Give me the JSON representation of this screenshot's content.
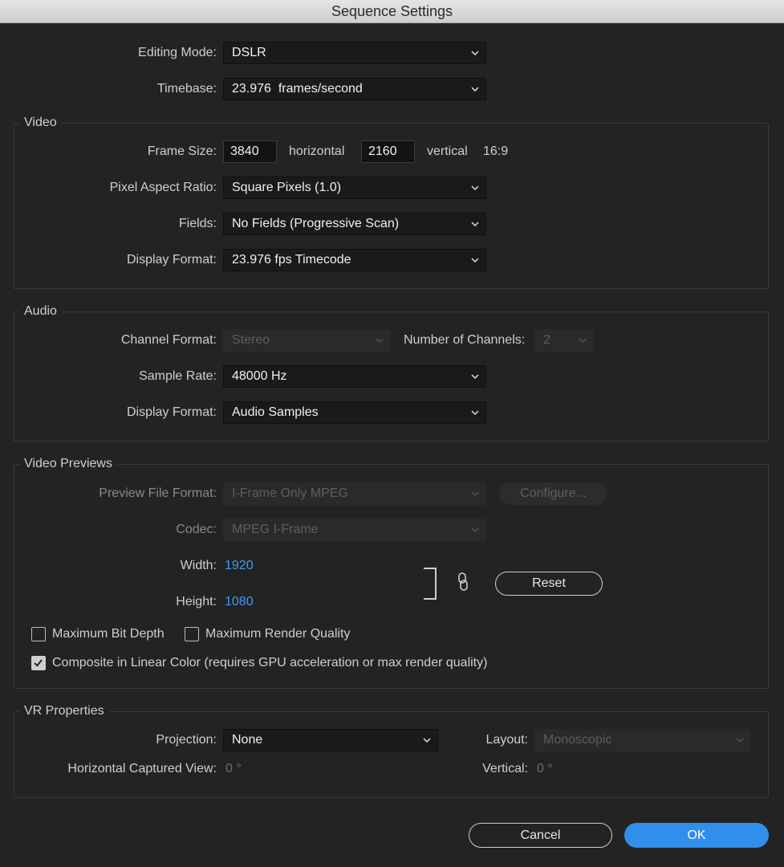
{
  "window": {
    "title": "Sequence Settings"
  },
  "general": {
    "editing_mode_label": "Editing Mode:",
    "editing_mode_value": "DSLR",
    "timebase_label": "Timebase:",
    "timebase_value": "23.976  frames/second"
  },
  "video": {
    "title": "Video",
    "frame_size_label": "Frame Size:",
    "frame_width": "3840",
    "horizontal_label": "horizontal",
    "frame_height": "2160",
    "vertical_label": "vertical",
    "aspect": "16:9",
    "par_label": "Pixel Aspect Ratio:",
    "par_value": "Square Pixels (1.0)",
    "fields_label": "Fields:",
    "fields_value": "No Fields (Progressive Scan)",
    "display_format_label": "Display Format:",
    "display_format_value": "23.976 fps Timecode"
  },
  "audio": {
    "title": "Audio",
    "channel_format_label": "Channel Format:",
    "channel_format_value": "Stereo",
    "num_channels_label": "Number of Channels:",
    "num_channels_value": "2",
    "sample_rate_label": "Sample Rate:",
    "sample_rate_value": "48000 Hz",
    "display_format_label": "Display Format:",
    "display_format_value": "Audio Samples"
  },
  "previews": {
    "title": "Video Previews",
    "file_format_label": "Preview File Format:",
    "file_format_value": "I-Frame Only MPEG",
    "configure_label": "Configure...",
    "codec_label": "Codec:",
    "codec_value": "MPEG I-Frame",
    "width_label": "Width:",
    "width_value": "1920",
    "height_label": "Height:",
    "height_value": "1080",
    "reset_label": "Reset",
    "max_bit_depth_label": "Maximum Bit Depth",
    "max_render_quality_label": "Maximum Render Quality",
    "linear_color_label": "Composite in Linear Color (requires GPU acceleration or max render quality)"
  },
  "vr": {
    "title": "VR Properties",
    "projection_label": "Projection:",
    "projection_value": "None",
    "layout_label": "Layout:",
    "layout_value": "Monoscopic",
    "h_view_label": "Horizontal Captured View:",
    "h_view_value": "0 °",
    "vertical_label": "Vertical:",
    "vertical_value": "0 °"
  },
  "footer": {
    "cancel_label": "Cancel",
    "ok_label": "OK"
  },
  "colors": {
    "accent": "#2f8fea",
    "link_blue": "#3f9bf2",
    "background": "#232323"
  }
}
